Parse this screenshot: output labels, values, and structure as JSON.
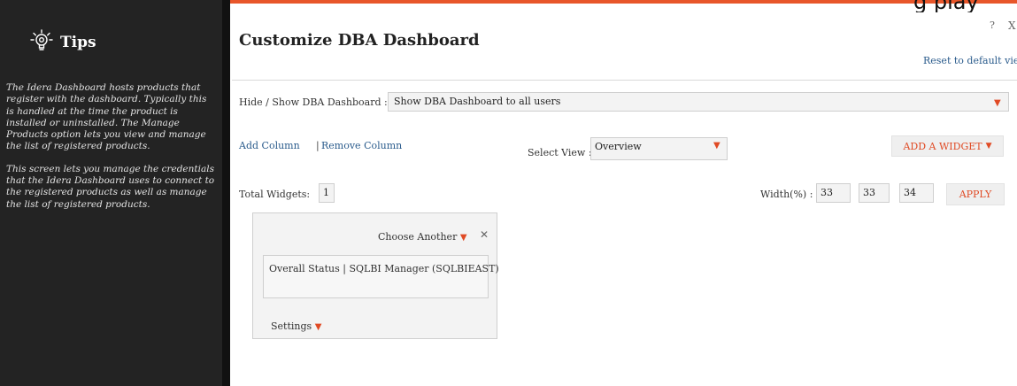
{
  "page": {
    "cut_off_text": "g  play"
  },
  "tips": {
    "title": "Tips",
    "paragraphs": [
      "The Idera Dashboard hosts products that register with the dashboard. Typically this is handled at the time the product is installed or uninstalled. The Manage Products option lets you view and manage the list of registered products.",
      "This screen lets you manage the credentials that the Idera Dashboard uses to connect to the registered products as well as manage the list of registered products."
    ]
  },
  "dialog": {
    "title": "Customize DBA Dashboard",
    "help_label": "?",
    "close_label": "X",
    "reset_label": "Reset to default view"
  },
  "visibility": {
    "label": "Hide / Show DBA Dashboard :",
    "value": "Show DBA Dashboard to all users"
  },
  "columns": {
    "add_label": "Add Column",
    "separator": "|",
    "remove_label": "Remove Column"
  },
  "view": {
    "label": "Select View :",
    "value": "Overview"
  },
  "add_widget_label": "ADD A WIDGET",
  "total": {
    "label": "Total Widgets:",
    "value": "1"
  },
  "width": {
    "label": "Width(%) :",
    "values": [
      "33",
      "33",
      "34"
    ]
  },
  "apply_label": "APPLY",
  "widget": {
    "choose_label": "Choose Another",
    "content": "Overall Status | SQLBI Manager (SQLBIEAST)",
    "settings_label": "Settings"
  },
  "colors": {
    "accent": "#e04a24",
    "link": "#2a5b8c",
    "sidebar": "#232323"
  }
}
